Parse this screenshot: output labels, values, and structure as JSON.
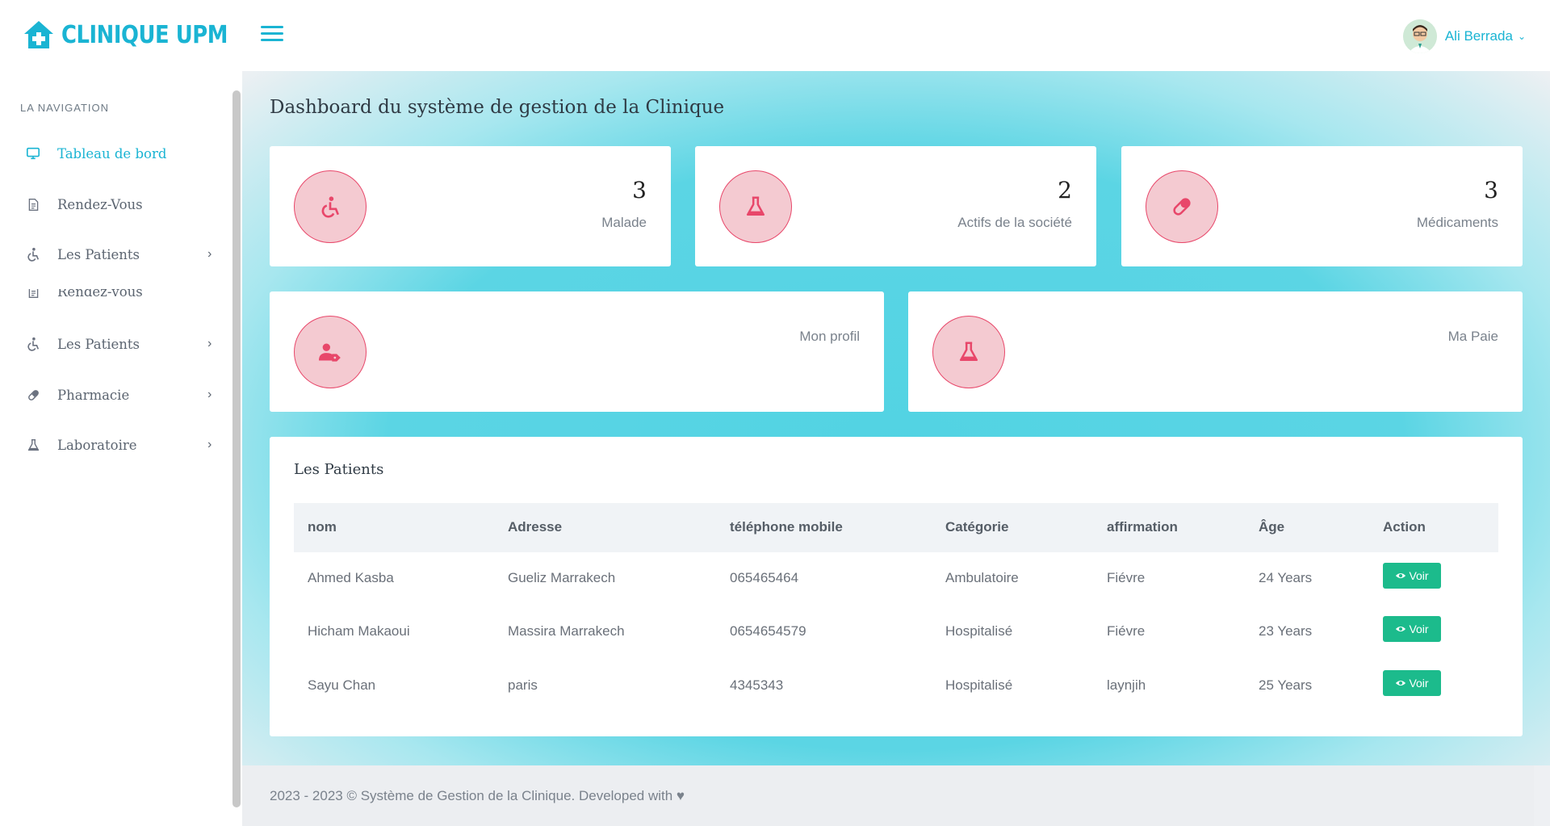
{
  "brand": {
    "name": "CLINIQUE UPM",
    "icon": "clinic-house-icon"
  },
  "header": {
    "user_name": "Ali Berrada",
    "menu_icon": "hamburger-menu-icon"
  },
  "sidebar": {
    "heading": "LA NAVIGATION",
    "items": [
      {
        "label": "Tableau de bord",
        "icon": "monitor-icon",
        "active": true
      },
      {
        "label": "Rendez-Vous",
        "icon": "document-icon"
      },
      {
        "label": "Les Patients",
        "icon": "wheelchair-icon",
        "has_submenu": true
      },
      {
        "label": "Rendez-vous",
        "icon": "document-icon"
      },
      {
        "label": "Les Patients",
        "icon": "wheelchair-icon",
        "has_submenu": true
      },
      {
        "label": "Pharmacie",
        "icon": "pill-icon",
        "has_submenu": true
      },
      {
        "label": "Laboratoire",
        "icon": "flask-icon",
        "has_submenu": true
      }
    ]
  },
  "page": {
    "title": "Dashboard du système de gestion de la Clinique"
  },
  "stats": [
    {
      "value": "3",
      "label": "Malade",
      "icon": "wheelchair-icon"
    },
    {
      "value": "2",
      "label": "Actifs de la société",
      "icon": "flask-icon"
    },
    {
      "value": "3",
      "label": "Médicaments",
      "icon": "pill-icon"
    }
  ],
  "shortcuts": [
    {
      "label": "Mon profil",
      "icon": "user-tag-icon"
    },
    {
      "label": "Ma Paie",
      "icon": "flask-icon"
    }
  ],
  "patients_table": {
    "title": "Les Patients",
    "columns": [
      "nom",
      "Adresse",
      "téléphone mobile",
      "Catégorie",
      "affirmation",
      "Âge",
      "Action"
    ],
    "rows": [
      [
        "Ahmed Kasba",
        "Gueliz Marrakech",
        "065465464",
        "Ambulatoire",
        "Fiévre",
        "24 Years"
      ],
      [
        "Hicham Makaoui",
        "Massira Marrakech",
        "0654654579",
        "Hospitalisé",
        "Fiévre",
        "23 Years"
      ],
      [
        "Sayu Chan",
        "paris",
        "4345343",
        "Hospitalisé",
        "laynjih",
        "25 Years"
      ]
    ],
    "action_label": "Voir"
  },
  "footer": {
    "text": "2023 - 2023 © Système de Gestion de la Clinique. Developed with ♥"
  },
  "colors": {
    "accent": "#1ab4d3",
    "stat_icon": "#e8476a",
    "button": "#1cbb8c",
    "glow": "#52d3e3"
  }
}
